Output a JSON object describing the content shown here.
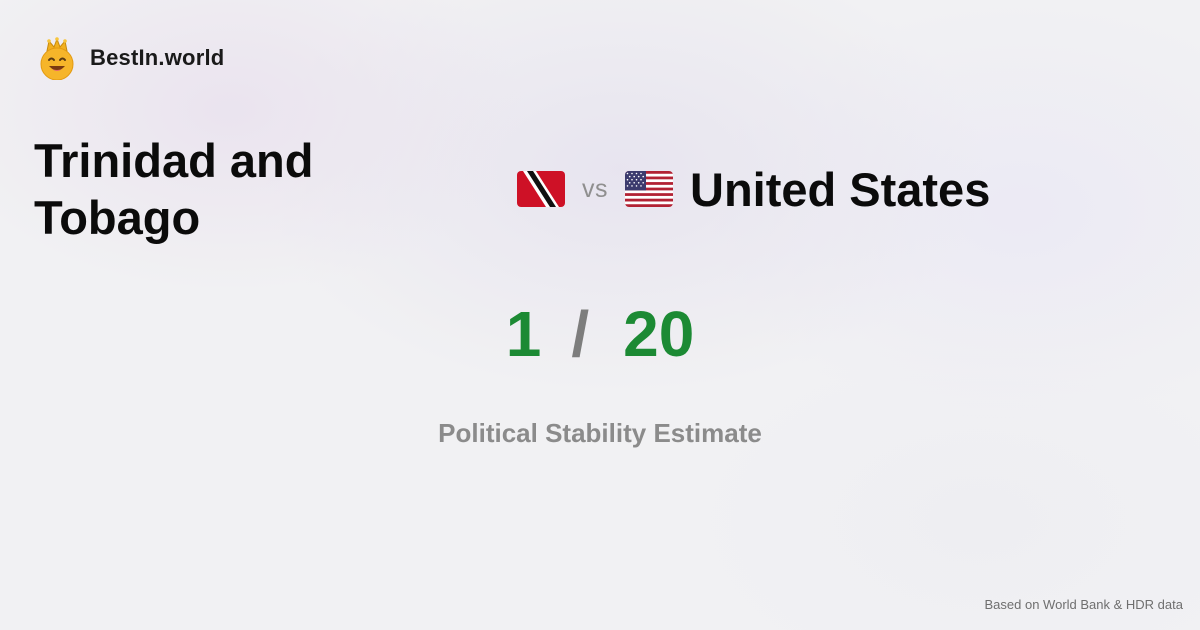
{
  "brand": {
    "name": "BestIn.world",
    "icon": "smiling-face-with-crown-icon"
  },
  "comparison": {
    "country_a": {
      "name": "Trinidad and Tobago",
      "flag_icon": "trinidad-and-tobago-flag-icon",
      "score": "1"
    },
    "vs_label": "vs",
    "country_b": {
      "name": "United States",
      "flag_icon": "united-states-flag-icon",
      "score": "20"
    },
    "separator": "/",
    "metric": "Political Stability Estimate"
  },
  "footer": {
    "source_note": "Based on World Bank & HDR data"
  },
  "colors": {
    "score_green": "#1c8a34",
    "muted_gray": "#8b8b8b",
    "text_dark": "#0b0b0b"
  }
}
